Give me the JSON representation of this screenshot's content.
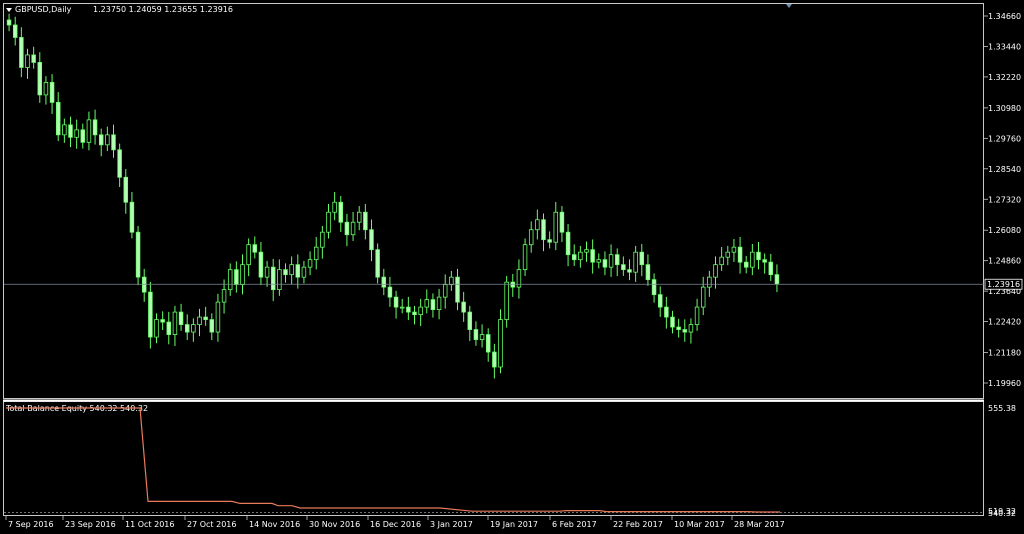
{
  "header": {
    "title": "GBPUSD,Daily",
    "ohlc": "1.23750 1.24059 1.23655 1.23916"
  },
  "indicator": {
    "label": "Total Balance Equity 540.32 540.32",
    "axis_labels": [
      "555.38",
      "519.32",
      "540.32"
    ]
  },
  "colors": {
    "background": "#000000",
    "bull": "#b6ffb6",
    "candle": "#66ff66",
    "grid": "#c8c8c8",
    "equity": "#e87a5a",
    "current_price_line": "#7f8a99"
  },
  "chart_data": {
    "type": "line",
    "title": "GBPUSD,Daily",
    "y_ticks": [
      "1.34660",
      "1.33440",
      "1.32220",
      "1.30980",
      "1.29760",
      "1.28540",
      "1.27320",
      "1.26080",
      "1.24860",
      "1.23640",
      "1.22420",
      "1.21180",
      "1.19960"
    ],
    "current_price": "1.23916",
    "x_ticks": [
      "7 Sep 2016",
      "23 Sep 2016",
      "11 Oct 2016",
      "27 Oct 2016",
      "14 Nov 2016",
      "30 Nov 2016",
      "16 Dec 2016",
      "3 Jan 2017",
      "19 Jan 2017",
      "6 Feb 2017",
      "22 Feb 2017",
      "10 Mar 2017",
      "28 Mar 2017"
    ],
    "ylim": [
      1.1935,
      1.3515
    ],
    "close_path": [
      1.343,
      1.338,
      1.326,
      1.331,
      1.328,
      1.315,
      1.32,
      1.312,
      1.299,
      1.303,
      1.298,
      1.301,
      1.296,
      1.305,
      1.299,
      1.295,
      1.299,
      1.293,
      1.282,
      1.272,
      1.26,
      1.242,
      1.236,
      1.218,
      1.225,
      1.224,
      1.219,
      1.228,
      1.223,
      1.22,
      1.223,
      1.226,
      1.225,
      1.22,
      1.232,
      1.237,
      1.245,
      1.239,
      1.247,
      1.255,
      1.252,
      1.242,
      1.246,
      1.237,
      1.245,
      1.243,
      1.247,
      1.242,
      1.246,
      1.249,
      1.254,
      1.26,
      1.268,
      1.272,
      1.264,
      1.259,
      1.264,
      1.268,
      1.261,
      1.253,
      1.242,
      1.238,
      1.234,
      1.23,
      1.23,
      1.228,
      1.227,
      1.23,
      1.233,
      1.229,
      1.234,
      1.239,
      1.242,
      1.232,
      1.228,
      1.221,
      1.217,
      1.219,
      1.212,
      1.206,
      1.225,
      1.24,
      1.238,
      1.245,
      1.255,
      1.261,
      1.265,
      1.257,
      1.256,
      1.268,
      1.26,
      1.251,
      1.249,
      1.252,
      1.253,
      1.248,
      1.249,
      1.246,
      1.251,
      1.247,
      1.245,
      1.244,
      1.252,
      1.247,
      1.241,
      1.235,
      1.23,
      1.226,
      1.222,
      1.221,
      1.22,
      1.223,
      1.23,
      1.238,
      1.242,
      1.247,
      1.25,
      1.252,
      1.254,
      1.248,
      1.246,
      1.252,
      1.249,
      1.248,
      1.243,
      1.2392
    ],
    "equity": {
      "name": "Total Balance Equity",
      "start": 555.38,
      "end": 519.32,
      "current": 540.32
    }
  }
}
